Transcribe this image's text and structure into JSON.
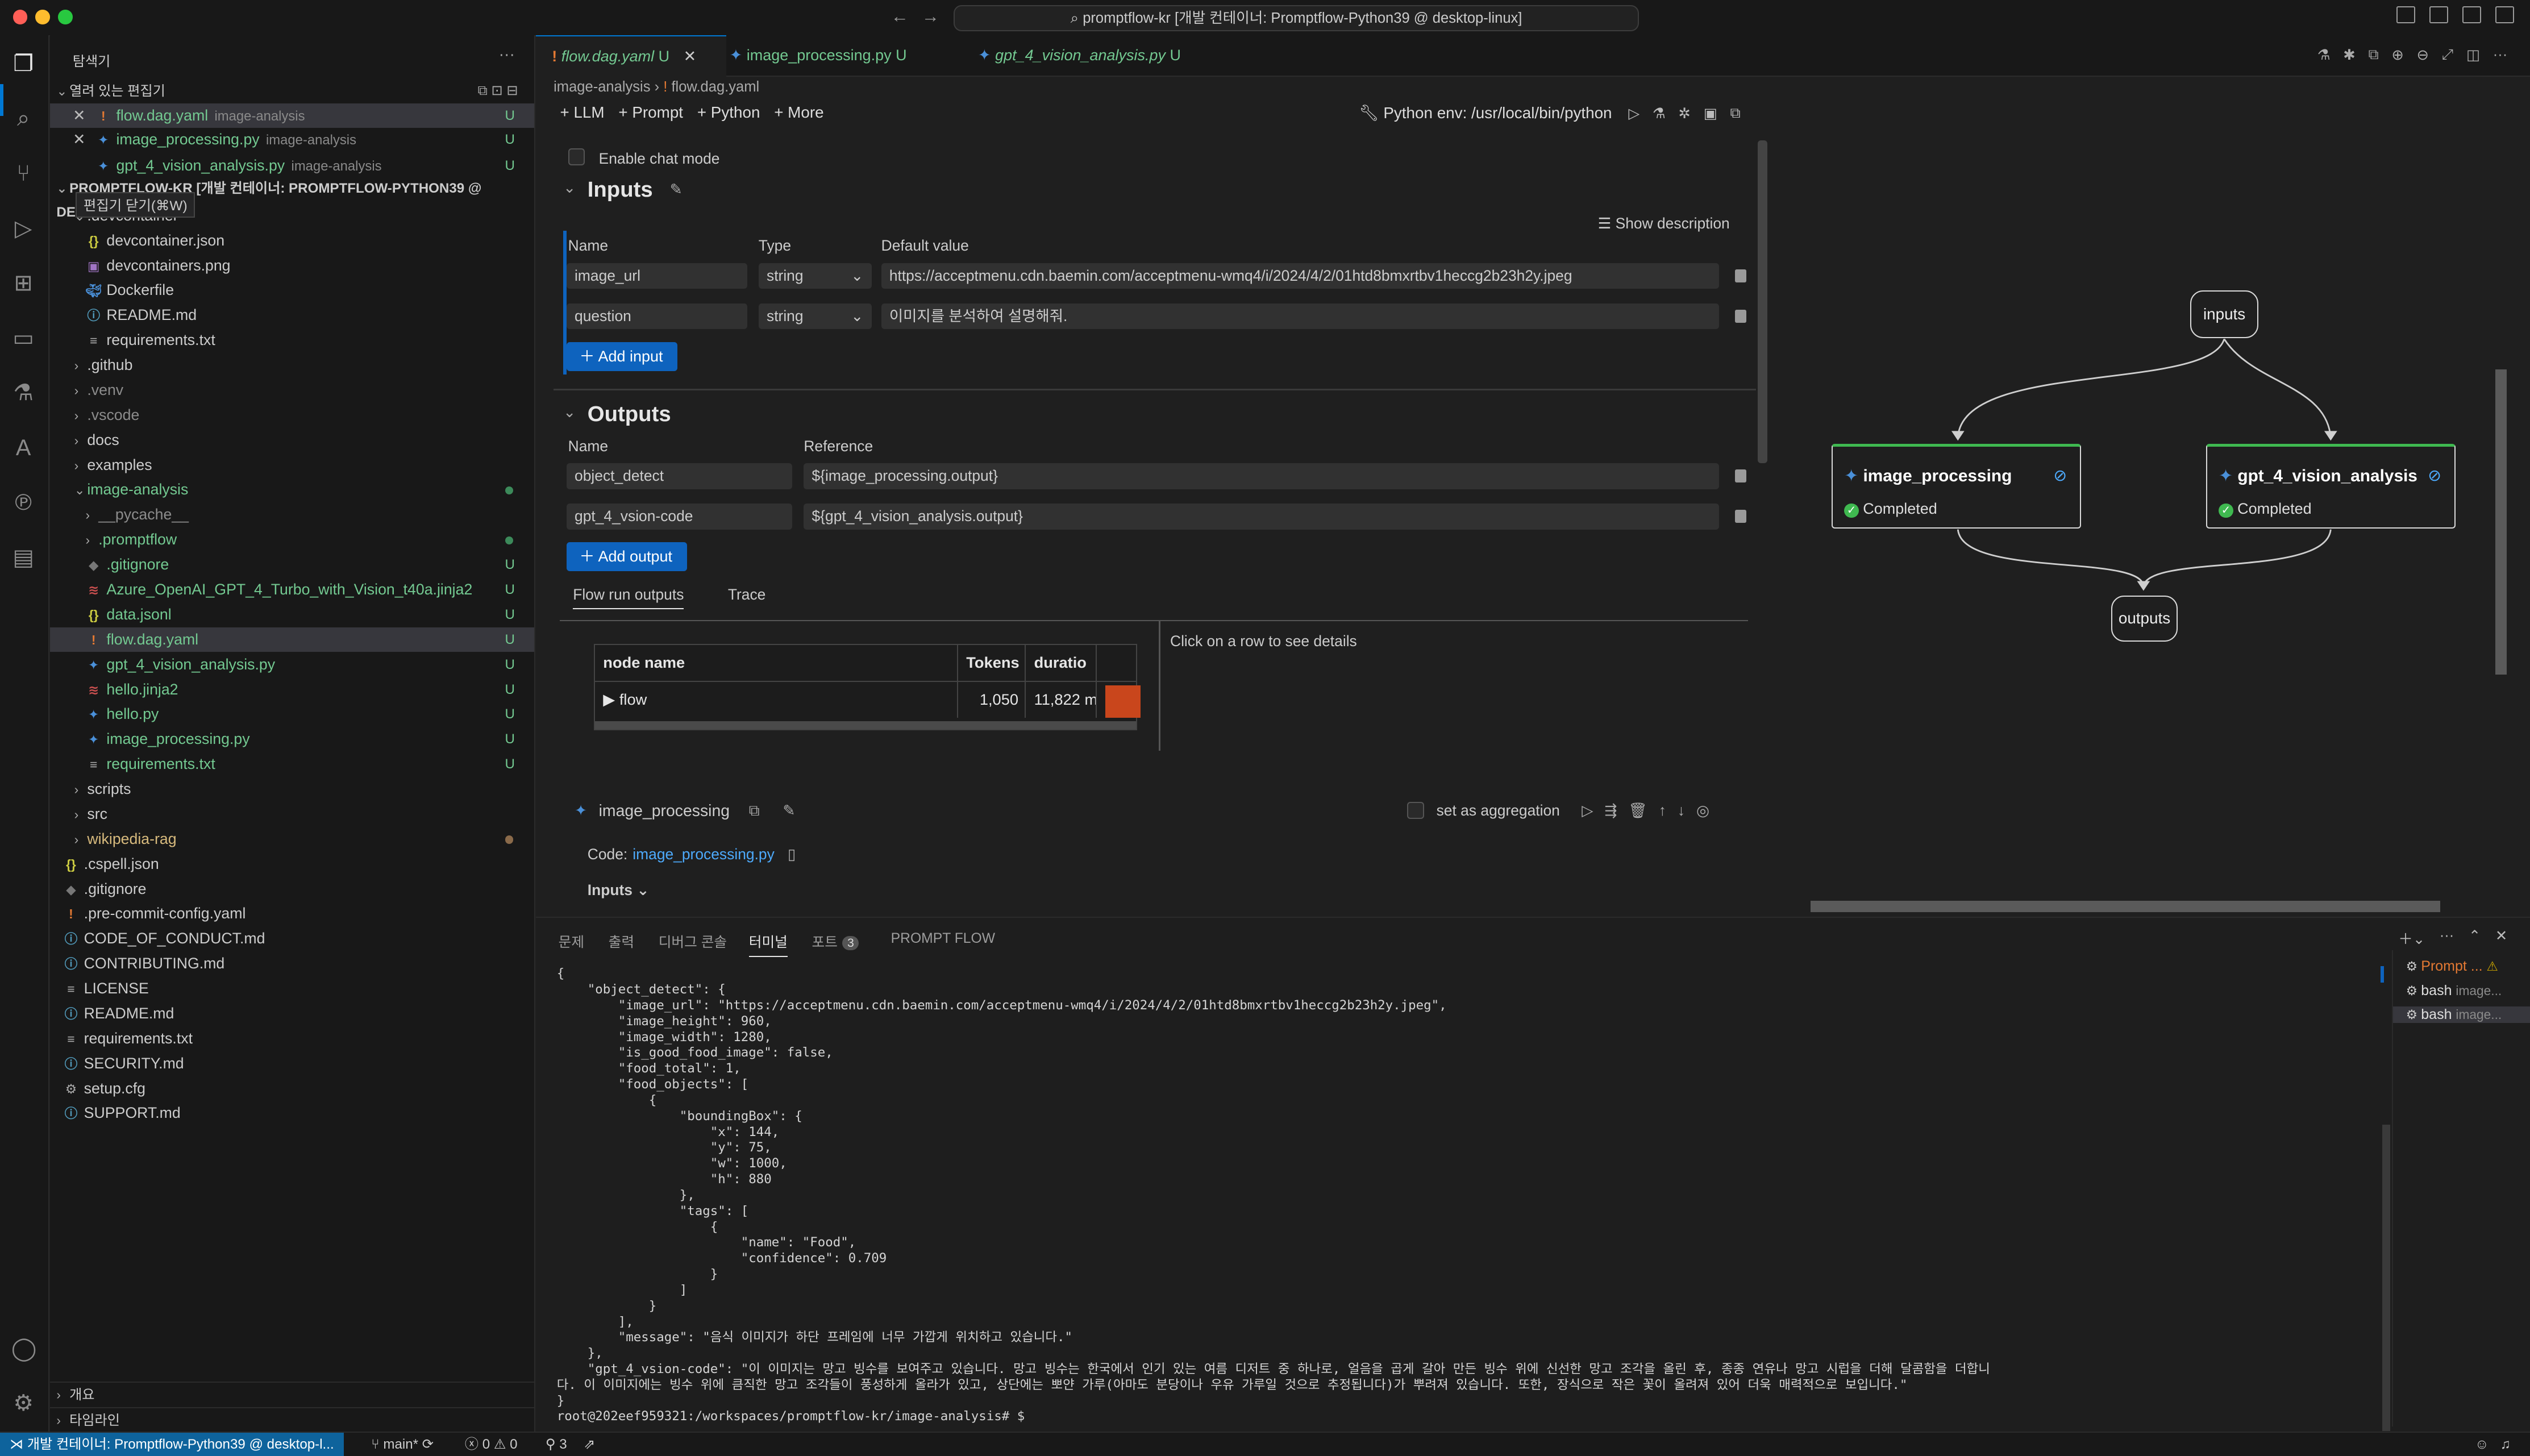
{
  "window": {
    "title": "promptflow-kr [개발 컨테이너: Promptflow-Python39 @ desktop-linux]"
  },
  "explorer": {
    "title": "탐색기",
    "open_editors_label": "열려 있는 편집기",
    "tooltip": "편집기 닫기(⌘W)",
    "open_editors": [
      {
        "name": "flow.dag.yaml",
        "desc": "image-analysis",
        "status": "U"
      },
      {
        "name": "image_processing.py",
        "desc": "image-analysis",
        "status": "U"
      },
      {
        "name": "gpt_4_vision_analysis.py",
        "desc": "image-analysis",
        "status": "U"
      }
    ],
    "root": "PROMPTFLOW-KR [개발 컨테이너: PROMPTFLOW-PYTHON39 @ DESKTO...",
    "tree": [
      {
        "name": ".devcontainer",
        "status": ""
      },
      {
        "name": "devcontainer.json",
        "status": ""
      },
      {
        "name": "devcontainers.png",
        "status": ""
      },
      {
        "name": "Dockerfile",
        "status": ""
      },
      {
        "name": "README.md",
        "status": ""
      },
      {
        "name": "requirements.txt",
        "status": ""
      },
      {
        "name": ".github",
        "status": ""
      },
      {
        "name": ".venv",
        "status": ""
      },
      {
        "name": ".vscode",
        "status": ""
      },
      {
        "name": "docs",
        "status": ""
      },
      {
        "name": "examples",
        "status": ""
      },
      {
        "name": "image-analysis",
        "status": ""
      },
      {
        "name": "__pycache__",
        "status": ""
      },
      {
        "name": ".promptflow",
        "status": ""
      },
      {
        "name": ".gitignore",
        "status": "U"
      },
      {
        "name": "Azure_OpenAI_GPT_4_Turbo_with_Vision_t40a.jinja2",
        "status": "U"
      },
      {
        "name": "data.jsonl",
        "status": "U"
      },
      {
        "name": "flow.dag.yaml",
        "status": "U"
      },
      {
        "name": "gpt_4_vision_analysis.py",
        "status": "U"
      },
      {
        "name": "hello.jinja2",
        "status": "U"
      },
      {
        "name": "hello.py",
        "status": "U"
      },
      {
        "name": "image_processing.py",
        "status": "U"
      },
      {
        "name": "requirements.txt",
        "status": "U"
      },
      {
        "name": "scripts",
        "status": ""
      },
      {
        "name": "src",
        "status": ""
      },
      {
        "name": "wikipedia-rag",
        "status": ""
      },
      {
        "name": ".cspell.json",
        "status": ""
      },
      {
        "name": ".gitignore",
        "status": ""
      },
      {
        "name": ".pre-commit-config.yaml",
        "status": ""
      },
      {
        "name": "CODE_OF_CONDUCT.md",
        "status": ""
      },
      {
        "name": "CONTRIBUTING.md",
        "status": ""
      },
      {
        "name": "LICENSE",
        "status": ""
      },
      {
        "name": "README.md",
        "status": ""
      },
      {
        "name": "requirements.txt",
        "status": ""
      },
      {
        "name": "SECURITY.md",
        "status": ""
      },
      {
        "name": "setup.cfg",
        "status": ""
      },
      {
        "name": "SUPPORT.md",
        "status": ""
      }
    ],
    "outline": "개요",
    "timeline": "타임라인"
  },
  "tabs": [
    {
      "label": "flow.dag.yaml",
      "status": "U"
    },
    {
      "label": "image_processing.py",
      "status": "U"
    },
    {
      "label": "gpt_4_vision_analysis.py",
      "status": "U"
    }
  ],
  "breadcrumb": {
    "folder": "image-analysis",
    "file": "flow.dag.yaml"
  },
  "toolbar": {
    "llm": "+ LLM",
    "prompt": "+ Prompt",
    "python": "+ Python",
    "more": "+ More",
    "python_env": "Python env: /usr/local/bin/python"
  },
  "flow": {
    "chat_mode": "Enable chat mode",
    "inputs_title": "Inputs",
    "show_description": "Show description",
    "col_name": "Name",
    "col_type": "Type",
    "col_default": "Default value",
    "inputs": [
      {
        "name": "image_url",
        "type": "string",
        "value": "https://acceptmenu.cdn.baemin.com/acceptmenu-wmq4/i/2024/4/2/01htd8bmxrtbv1heccg2b23h2y.jpeg"
      },
      {
        "name": "question",
        "type": "string",
        "value": "이미지를 분석하여 설명해줘."
      }
    ],
    "add_input": "Add input",
    "outputs_title": "Outputs",
    "col_reference": "Reference",
    "outputs": [
      {
        "name": "object_detect",
        "ref": "${image_processing.output}"
      },
      {
        "name": "gpt_4_vsion-code",
        "ref": "${gpt_4_vision_analysis.output}"
      }
    ],
    "add_output": "Add output",
    "run_tab": "Flow run outputs",
    "trace_tab": "Trace",
    "table_cols": [
      "node name",
      "Tokens",
      "duratio"
    ],
    "table_row": {
      "node": "▶ flow",
      "tokens": "1,050",
      "duration": "11,822 m"
    },
    "details_hint": "Click on a row to see details",
    "node_name": "image_processing",
    "aggregation": "set as aggregation",
    "code_label": "Code:",
    "code_file": "image_processing.py",
    "node_inputs": "Inputs"
  },
  "graph": {
    "inputs": "inputs",
    "outputs": "outputs",
    "nodes": [
      {
        "name": "image_processing",
        "status": "Completed"
      },
      {
        "name": "gpt_4_vision_analysis",
        "status": "Completed"
      }
    ]
  },
  "panel": {
    "tabs": [
      "문제",
      "출력",
      "디버그 콘솔",
      "터미널",
      "포트",
      "PROMPT FLOW"
    ],
    "ports_count": "3",
    "terminal_text": "{\n    \"object_detect\": {\n        \"image_url\": \"https://acceptmenu.cdn.baemin.com/acceptmenu-wmq4/i/2024/4/2/01htd8bmxrtbv1heccg2b23h2y.jpeg\",\n        \"image_height\": 960,\n        \"image_width\": 1280,\n        \"is_good_food_image\": false,\n        \"food_total\": 1,\n        \"food_objects\": [\n            {\n                \"boundingBox\": {\n                    \"x\": 144,\n                    \"y\": 75,\n                    \"w\": 1000,\n                    \"h\": 880\n                },\n                \"tags\": [\n                    {\n                        \"name\": \"Food\",\n                        \"confidence\": 0.709\n                    }\n                ]\n            }\n        ],\n        \"message\": \"음식 이미지가 하단 프레임에 너무 가깝게 위치하고 있습니다.\"\n    },\n    \"gpt_4_vsion-code\": \"이 이미지는 망고 빙수를 보여주고 있습니다. 망고 빙수는 한국에서 인기 있는 여름 디저트 중 하나로, 얼음을 곱게 갈아 만든 빙수 위에 신선한 망고 조각을 올린 후, 종종 연유나 망고 시럽을 더해 달콤함을 더합니\n다. 이 이미지에는 빙수 위에 큼직한 망고 조각들이 풍성하게 올라가 있고, 상단에는 뽀얀 가루(아마도 분당이나 우유 가루일 것으로 추정됩니다)가 뿌려져 있습니다. 또한, 장식으로 작은 꽃이 올려져 있어 더욱 매력적으로 보입니다.\"\n}\nroot@202eef959321:/workspaces/promptflow-kr/image-analysis# $",
    "terminals": [
      {
        "name": "Prompt ...",
        "sub": ""
      },
      {
        "name": "bash",
        "sub": "image..."
      },
      {
        "name": "bash",
        "sub": "image..."
      }
    ]
  },
  "status": {
    "remote": "개발 컨테이너: Promptflow-Python39 @ desktop-l...",
    "branch": "main*",
    "problems": "0 ⚠ 0",
    "ports": "3"
  }
}
